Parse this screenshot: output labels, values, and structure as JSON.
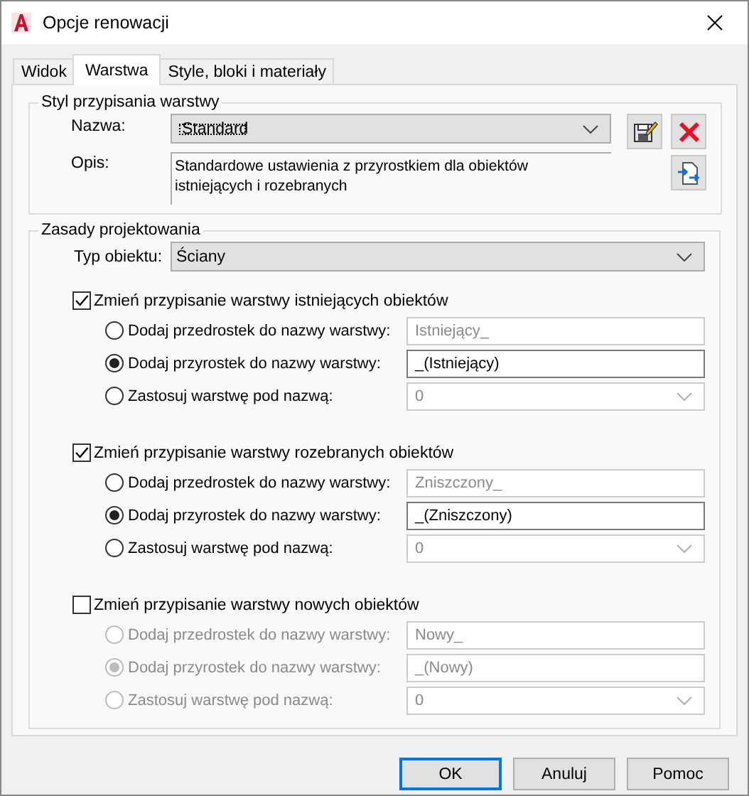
{
  "window": {
    "title": "Opcje renowacji"
  },
  "tabs": [
    {
      "label": "Widok",
      "selected": false
    },
    {
      "label": "Warstwa",
      "selected": true
    },
    {
      "label": "Style, bloki i materiały",
      "selected": false
    }
  ],
  "style_group": {
    "title": "Styl przypisania warstwy",
    "name_label": "Nazwa:",
    "name_value": "Standard",
    "description_label": "Opis:",
    "description": "Standardowe ustawienia z przyrostkiem dla obiektów istniejących i rozebranych"
  },
  "rules_group": {
    "title": "Zasady projektowania",
    "object_type_label": "Typ obiektu:",
    "object_type_value": "Ściany",
    "rules": [
      {
        "label": "Zmień przypisanie warstwy istniejących obiektów",
        "checked": true,
        "options": [
          {
            "label": "Dodaj przedrostek do nazwy warstwy:",
            "kind": "text",
            "value": "Istniejący_",
            "selected": false
          },
          {
            "label": "Dodaj przyrostek do nazwy warstwy:",
            "kind": "text",
            "value": "_(Istniejący)",
            "selected": true
          },
          {
            "label": "Zastosuj warstwę pod nazwą:",
            "kind": "combo",
            "value": "0",
            "selected": false
          }
        ]
      },
      {
        "label": "Zmień przypisanie warstwy rozebranych obiektów",
        "checked": true,
        "options": [
          {
            "label": "Dodaj przedrostek do nazwy warstwy:",
            "kind": "text",
            "value": "Zniszczony_",
            "selected": false
          },
          {
            "label": "Dodaj przyrostek do nazwy warstwy:",
            "kind": "text",
            "value": "_(Zniszczony)",
            "selected": true
          },
          {
            "label": "Zastosuj warstwę pod nazwą:",
            "kind": "combo",
            "value": "0",
            "selected": false
          }
        ]
      },
      {
        "label": "Zmień przypisanie warstwy nowych obiektów",
        "checked": false,
        "options": [
          {
            "label": "Dodaj przedrostek do nazwy warstwy:",
            "kind": "text",
            "value": "Nowy_",
            "selected": false
          },
          {
            "label": "Dodaj przyrostek do nazwy warstwy:",
            "kind": "text",
            "value": "_(Nowy)",
            "selected": true
          },
          {
            "label": "Zastosuj warstwę pod nazwą:",
            "kind": "combo",
            "value": "0",
            "selected": false
          }
        ]
      }
    ]
  },
  "buttons": [
    {
      "label": "OK",
      "default": true
    },
    {
      "label": "Anuluj",
      "default": false
    },
    {
      "label": "Pomoc",
      "default": false
    }
  ]
}
